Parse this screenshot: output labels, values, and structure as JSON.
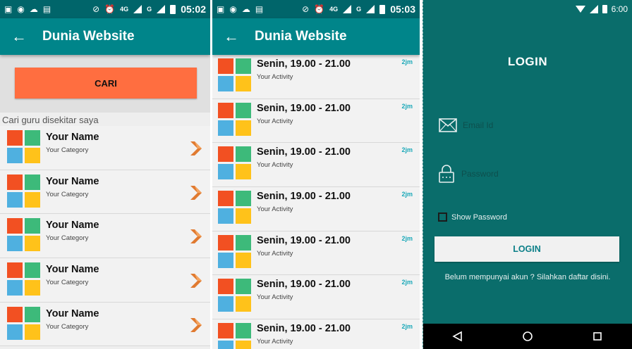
{
  "screens": {
    "search": {
      "status": {
        "time": "05:02",
        "network": "4G",
        "network2": "G"
      },
      "toolbar": {
        "title": "Dunia Website"
      },
      "search_button": "CARI",
      "section_label": "Cari guru disekitar saya",
      "items": [
        {
          "name": "Your Name",
          "category": "Your Category"
        },
        {
          "name": "Your Name",
          "category": "Your Category"
        },
        {
          "name": "Your Name",
          "category": "Your Category"
        },
        {
          "name": "Your Name",
          "category": "Your Category"
        },
        {
          "name": "Your Name",
          "category": "Your Category"
        }
      ]
    },
    "schedule": {
      "status": {
        "time": "05:03",
        "network": "4G",
        "network2": "G"
      },
      "toolbar": {
        "title": "Dunia Website"
      },
      "items": [
        {
          "time": "Senin, 19.00 - 21.00",
          "activity": "Your Activity",
          "ago": "2jm"
        },
        {
          "time": "Senin, 19.00 - 21.00",
          "activity": "Your Activity",
          "ago": "2jm"
        },
        {
          "time": "Senin, 19.00 - 21.00",
          "activity": "Your Activity",
          "ago": "2jm"
        },
        {
          "time": "Senin, 19.00 - 21.00",
          "activity": "Your Activity",
          "ago": "2jm"
        },
        {
          "time": "Senin, 19.00 - 21.00",
          "activity": "Your Activity",
          "ago": "2jm"
        },
        {
          "time": "Senin, 19.00 - 21.00",
          "activity": "Your Activity",
          "ago": "2jm"
        },
        {
          "time": "Senin, 19.00 - 21.00",
          "activity": "Your Activity",
          "ago": "2jm"
        }
      ]
    },
    "login": {
      "status": {
        "time": "6:00"
      },
      "title": "LOGIN",
      "email_placeholder": "Email Id",
      "password_placeholder": "Password",
      "show_password": "Show Password",
      "login_button": "LOGIN",
      "register_text": "Belum mempunyai akun ? Silahkan daftar disini."
    }
  },
  "colors": {
    "status_bar": "#00656a",
    "toolbar": "#00858a",
    "search_button": "#ff6e40",
    "login_bg": "#0a6d6b",
    "accent_time": "#1aa8b8",
    "logo": [
      "#f25022",
      "#3dba7a",
      "#4fb0e0",
      "#ffc21a"
    ]
  },
  "icons": {
    "back": "arrow-left-icon",
    "chevron": "chevron-right-icon",
    "email": "envelope-icon",
    "password": "lock-icon",
    "nav": [
      "back-triangle-icon",
      "home-circle-icon",
      "recents-square-icon"
    ]
  }
}
